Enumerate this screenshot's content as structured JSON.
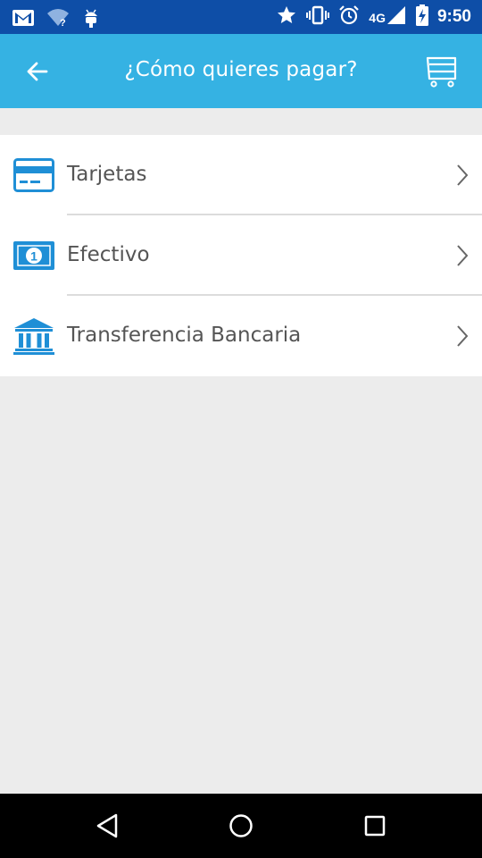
{
  "status_bar": {
    "network_label": "4G",
    "time": "9:50",
    "background": "#0e4ea7",
    "icons": [
      "gmail-icon",
      "wifi-unknown-icon",
      "android-debug-icon",
      "star-icon",
      "vibrate-icon",
      "alarm-icon",
      "signal-icon",
      "battery-charging-icon"
    ]
  },
  "app_bar": {
    "title": "¿Cómo quieres pagar?",
    "background": "#35b2e3",
    "back_icon": "arrow-left-icon",
    "cart_icon": "cart-icon"
  },
  "payment_methods": [
    {
      "label": "Tarjetas",
      "icon": "credit-card-icon"
    },
    {
      "label": "Efectivo",
      "icon": "cash-icon"
    },
    {
      "label": "Transferencia Bancaria",
      "icon": "bank-icon"
    }
  ],
  "accent_color": "#1f8fd6",
  "nav_bar": {
    "icons": [
      "back-triangle-icon",
      "home-circle-icon",
      "recents-square-icon"
    ]
  }
}
